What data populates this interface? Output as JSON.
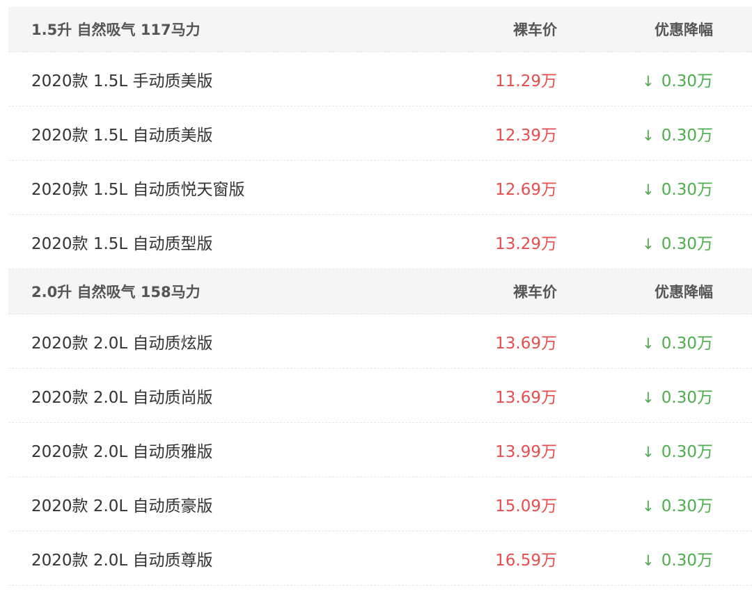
{
  "groups": [
    {
      "title": "1.5升 自然吸气 117马力",
      "price_header": "裸车价",
      "discount_header": "优惠降幅",
      "rows": [
        {
          "name": "2020款 1.5L 手动质美版",
          "price": "11.29万",
          "discount": "0.30万"
        },
        {
          "name": "2020款 1.5L 自动质美版",
          "price": "12.39万",
          "discount": "0.30万"
        },
        {
          "name": "2020款 1.5L 自动质悦天窗版",
          "price": "12.69万",
          "discount": "0.30万"
        },
        {
          "name": "2020款 1.5L 自动质型版",
          "price": "13.29万",
          "discount": "0.30万"
        }
      ]
    },
    {
      "title": "2.0升 自然吸气 158马力",
      "price_header": "裸车价",
      "discount_header": "优惠降幅",
      "rows": [
        {
          "name": "2020款 2.0L 自动质炫版",
          "price": "13.69万",
          "discount": "0.30万"
        },
        {
          "name": "2020款 2.0L 自动质尚版",
          "price": "13.69万",
          "discount": "0.30万"
        },
        {
          "name": "2020款 2.0L 自动质雅版",
          "price": "13.99万",
          "discount": "0.30万"
        },
        {
          "name": "2020款 2.0L 自动质豪版",
          "price": "15.09万",
          "discount": "0.30万"
        },
        {
          "name": "2020款 2.0L 自动质尊版",
          "price": "16.59万",
          "discount": "0.30万"
        }
      ]
    }
  ],
  "icons": {
    "discount": "arrow-down-icon"
  },
  "colors": {
    "price": "#e84c4c",
    "discount": "#4cae4c",
    "header_bg": "#f5f5f5"
  }
}
